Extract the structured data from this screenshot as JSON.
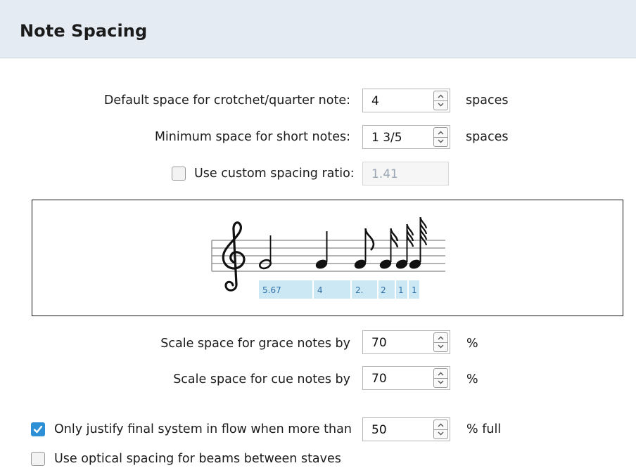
{
  "header": {
    "title": "Note Spacing"
  },
  "default_space": {
    "label": "Default space for crotchet/quarter note:",
    "value": "4",
    "unit": "spaces"
  },
  "minimum_space": {
    "label": "Minimum space for short notes:",
    "value": "1 3/5",
    "unit": "spaces"
  },
  "custom_ratio": {
    "label": "Use custom spacing ratio:",
    "checked": false,
    "value": "1.41"
  },
  "preview": {
    "spacing_labels": [
      "5.67",
      "4",
      "2.",
      "2",
      "1",
      "1"
    ]
  },
  "grace_notes": {
    "label": "Scale space for grace notes by",
    "value": "70",
    "unit": "%"
  },
  "cue_notes": {
    "label": "Scale space for cue notes by",
    "value": "70",
    "unit": "%"
  },
  "justify_final": {
    "label": "Only justify final system in flow when more than",
    "checked": true,
    "value": "50",
    "unit": "% full"
  },
  "optical_spacing": {
    "label": "Use optical spacing for beams between staves",
    "checked": false
  },
  "colors": {
    "header_bg": "#e4ebf3",
    "checkbox_accent": "#2d8fd5",
    "spacing_band": "#cce8f4"
  }
}
